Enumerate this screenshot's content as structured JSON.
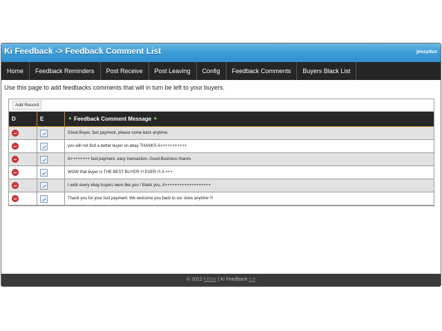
{
  "header": {
    "title": "Ki Feedback -> Feedback Comment List",
    "user": "jessydus"
  },
  "nav": [
    "Home",
    "Feedback Reminders",
    "Post Receive",
    "Post Leaving",
    "Config",
    "Feedback Comments",
    "Buyers Black List"
  ],
  "intro": "Use this page to add feedbacks comments that will in turn be left to your buyers.",
  "grid": {
    "add_record": "Add Record",
    "headers": {
      "d": "D",
      "e": "E",
      "message": "Feedback Comment Message"
    },
    "rows": [
      "Great Buyer, fast payment, please come back anytime.",
      "you will not find a better buyer on ebay THANKS A+++++++++++",
      "A++++++++ fast payment, easy transaction. Good Business thanks",
      "WOW that buyer is THE BEST BUYER !!! EVER !!! A +++",
      "I wish every ebay buyers were like you ! thank you, A+++++++++++++++++++",
      "Thank you for your fast payment. We welcome you back to our store anytime !!!"
    ]
  },
  "footer": {
    "copyright": "© 2012",
    "company": "KiDus",
    "separator": "|",
    "product": "Ki Feedback",
    "version": "1.0"
  },
  "colors": {
    "title_blue": "#3f9fd8",
    "nav_dark": "#262626",
    "row_alt": "#e2e2e2",
    "header_accent": "#d38b1c"
  }
}
